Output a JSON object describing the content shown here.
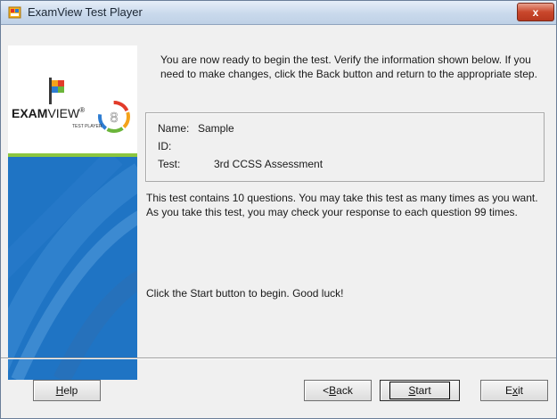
{
  "window": {
    "title": "ExamView Test Player",
    "close_label": "x"
  },
  "logo": {
    "word_bold": "EXAM",
    "word_light": "VIEW",
    "mark": "®",
    "subtitle": "TEST PLAYER"
  },
  "main": {
    "intro_text": "You are now ready to begin the test.  Verify the information shown below.  If you need to make changes, click the Back button and return to the appropriate step.",
    "info": [
      {
        "label": "Name:",
        "value": "Sample"
      },
      {
        "label": "ID:",
        "value": ""
      },
      {
        "label": "Test:",
        "value": "3rd CCSS Assessment"
      }
    ],
    "description": "This test contains 10 questions.  You may take this test as many times as you want.  As you take this test, you may check your response to each question 99 times.",
    "start_prompt": "Click the Start button to begin.  Good luck!"
  },
  "buttons": {
    "help": {
      "pre": "",
      "u": "H",
      "post": "elp"
    },
    "back": {
      "pre": "< ",
      "u": "B",
      "post": "ack"
    },
    "start": {
      "pre": "",
      "u": "S",
      "post": "tart"
    },
    "exit": {
      "pre": "E",
      "u": "x",
      "post": "it"
    }
  },
  "colors": {
    "brand_blue": "#1f74c4",
    "brand_green": "#8cc63f",
    "close_red": "#c9472c"
  }
}
